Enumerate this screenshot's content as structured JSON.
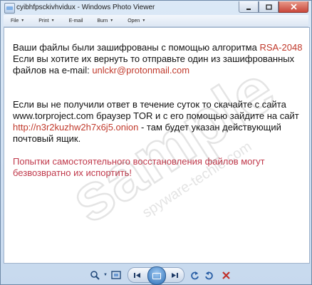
{
  "window": {
    "title": "cyibhfpsckivhvidux - Windows Photo Viewer"
  },
  "menubar": {
    "items": [
      {
        "label": "File"
      },
      {
        "label": "Print"
      },
      {
        "label": "E-mail"
      },
      {
        "label": "Burn"
      },
      {
        "label": "Open"
      }
    ]
  },
  "note": {
    "p1_line1": "Ваши файлы были зашифрованы с помощью алгоритма ",
    "p1_algo": "RSA-2048",
    "p1_line2": "Если вы хотите их вернуть то отправьте один из зашифрованных",
    "p1_line3_a": "файлов    на e-mail: ",
    "p1_email": "unlckr@protonmail.com",
    "p2_line1": "Если вы не получили ответ в течение суток то скачайте с сайта",
    "p2_line2": "www.torproject.com браузер TOR и с его помощью зайдите на сайт",
    "p2_onion": "http://n3r2kuzhw2h7x6j5.onion",
    "p2_line3_b": " - там будет указан действующий",
    "p2_line4": "почтовый ящик.",
    "p3_line1": "Попытки самостоятельного восстановления файлов могут",
    "p3_line2": "безвозвратно их испортить!"
  },
  "watermark": {
    "text": "sample",
    "sub": "spyware-techie.com"
  },
  "colors": {
    "accent_red": "#c0392b",
    "chrome_blue": "#c7d9ee"
  }
}
